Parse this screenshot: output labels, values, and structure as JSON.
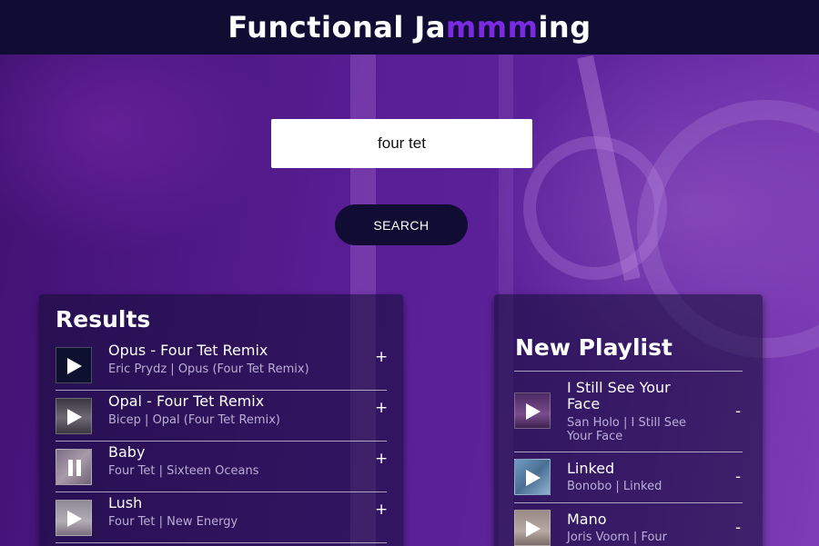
{
  "header": {
    "title_start": "Functional Ja",
    "title_accent": "mmm",
    "title_end": "ing"
  },
  "search": {
    "value": "four tet",
    "button_label": "SEARCH"
  },
  "results": {
    "title": "Results",
    "tracks": [
      {
        "name": "Opus - Four Tet Remix",
        "meta": "Eric Prydz | Opus (Four Tet Remix)",
        "action": "+",
        "state": "paused",
        "thumb_color": "#0e1030"
      },
      {
        "name": "Opal - Four Tet Remix",
        "meta": "Bicep | Opal (Four Tet Remix)",
        "action": "+",
        "state": "paused",
        "thumb_color": "#5b5560"
      },
      {
        "name": "Baby",
        "meta": "Four Tet | Sixteen Oceans",
        "action": "+",
        "state": "playing",
        "thumb_color": "#8a7d8c"
      },
      {
        "name": "Lush",
        "meta": "Four Tet | New Energy",
        "action": "+",
        "state": "paused",
        "thumb_color": "#8f8a90"
      }
    ]
  },
  "playlist": {
    "title": "New Playlist",
    "tracks": [
      {
        "name": "I Still See Your Face",
        "meta": "San Holo | I Still See Your Face",
        "action": "-",
        "thumb_color": "#6b3d7c"
      },
      {
        "name": "Linked",
        "meta": "Bonobo | Linked",
        "action": "-",
        "thumb_color": "#5a7fa4"
      },
      {
        "name": "Mano",
        "meta": "Joris Voorn | Four",
        "action": "-",
        "thumb_color": "#8e7a7a"
      }
    ]
  },
  "colors": {
    "header_bg": "#100c33",
    "brand_accent": "#7a2be2",
    "button_bg": "#100c33",
    "panel_bg": "rgba(16,12,51,0.55)"
  }
}
